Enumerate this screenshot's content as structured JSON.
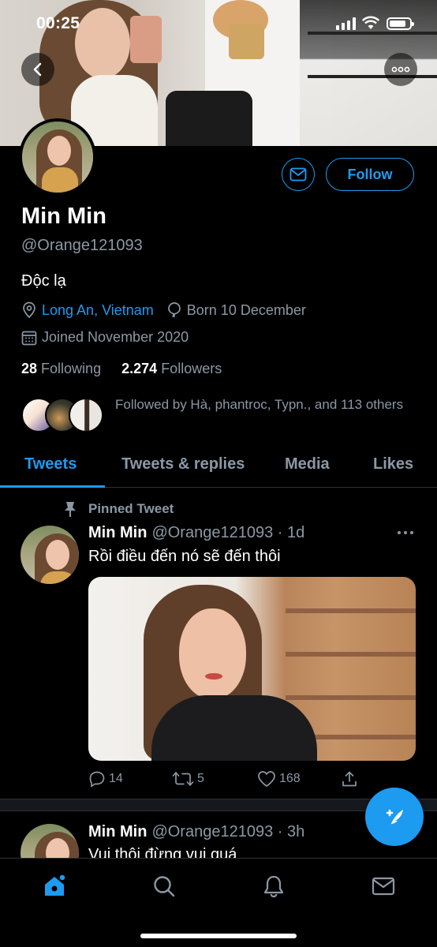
{
  "status_bar": {
    "time": "00:25"
  },
  "profile": {
    "name": "Min Min",
    "handle": "@Orange121093",
    "bio": "Độc lạ",
    "location": "Long An, Vietnam",
    "birthday": "Born 10 December",
    "joined": "Joined November 2020",
    "following_count": "28",
    "following_label": "Following",
    "followers_count": "2.274",
    "followers_label": "Followers",
    "followed_by": "Followed by Hà, phantroc, Typn., and 113 others",
    "follow_button": "Follow"
  },
  "tabs": [
    {
      "label": "Tweets",
      "active": true
    },
    {
      "label": "Tweets & replies",
      "active": false
    },
    {
      "label": "Media",
      "active": false
    },
    {
      "label": "Likes",
      "active": false
    }
  ],
  "tweets": [
    {
      "pinned_label": "Pinned Tweet",
      "name": "Min Min",
      "meta": "@Orange121093 · 1d",
      "text": "Rồi điều đến nó sẽ đến thôi",
      "replies": "14",
      "retweets": "5",
      "likes": "168"
    },
    {
      "name": "Min Min",
      "meta": "@Orange121093 · 3h",
      "text": "Vui thôi đừng vui quá"
    }
  ],
  "colors": {
    "accent": "#1d9bf0",
    "background": "#000000",
    "muted": "#8b98a5"
  },
  "icons": {
    "back": "chevron-left-icon",
    "more": "ellipsis-icon",
    "mail": "envelope-icon",
    "location": "map-pin-icon",
    "birthday": "balloon-icon",
    "joined": "calendar-icon",
    "pin": "pin-icon",
    "reply": "reply-icon",
    "retweet": "retweet-icon",
    "like": "heart-icon",
    "share": "share-icon",
    "compose": "compose-tweet-icon",
    "nav": [
      "home-icon",
      "search-icon",
      "notifications-icon",
      "messages-icon"
    ]
  }
}
